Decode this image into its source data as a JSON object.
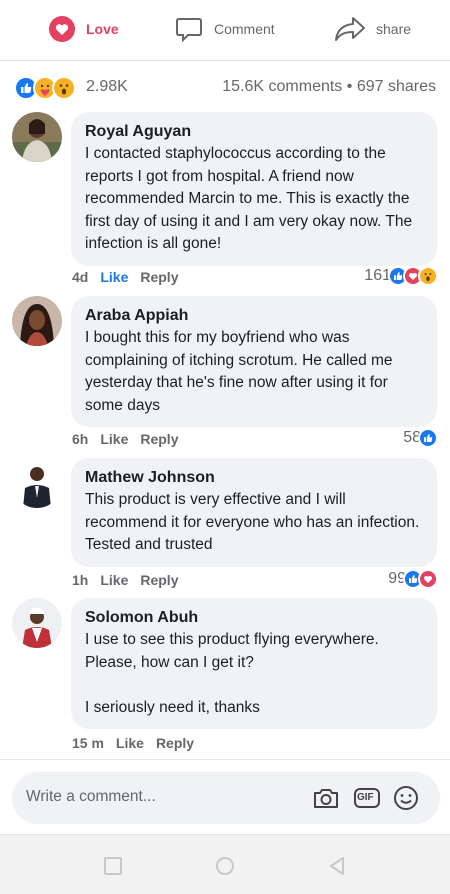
{
  "actions": {
    "love_label": "Love",
    "comment_label": "Comment",
    "share_label": "share"
  },
  "summary": {
    "reactions": [
      "like-reaction-icon",
      "love-reaction-icon",
      "wow-reaction-icon"
    ],
    "reaction_count": "2.98K",
    "comments_count": "15.6K comments",
    "separator": "•",
    "shares_count": "697 shares"
  },
  "comments": [
    {
      "author": "Royal Aguyan",
      "text": "I contacted staphylococcus according to the reports I got from hospital. A friend now recommended Marcin to me. This is exactly the first day of using it and I am very okay now. The infection is all gone!",
      "time": "4d",
      "like_label": "Like",
      "reply_label": "Reply",
      "reaction_count": "161",
      "reactions": [
        "like-reaction-icon",
        "love-reaction-icon",
        "wow-reaction-icon"
      ]
    },
    {
      "author": "Araba Appiah",
      "text": "I bought this for my boyfriend who was complaining of itching scrotum. He called me yesterday that he's fine now after using it for some days",
      "time": "6h",
      "like_label": "Like",
      "reply_label": "Reply",
      "reaction_count": "58",
      "reactions": [
        "like-reaction-icon"
      ]
    },
    {
      "author": "Mathew Johnson",
      "text": "This product is very effective and I will recommend it for everyone who has an infection. Tested and trusted",
      "time": "1h",
      "like_label": "Like",
      "reply_label": "Reply",
      "reaction_count": "99",
      "reactions": [
        "like-reaction-icon",
        "love-reaction-icon"
      ]
    },
    {
      "author": "Solomon Abuh",
      "text": "I use to see this product flying everywhere. Please, how can I get it?\n\nI seriously need it, thanks",
      "time": "15 m",
      "like_label": "Like",
      "reply_label": "Reply",
      "reaction_count": "",
      "reactions": []
    }
  ],
  "composer": {
    "placeholder": "Write a comment...",
    "gif_label": "GIF"
  },
  "colors": {
    "love_red": "#e4405f",
    "like_blue": "#1877f2",
    "bubble_bg": "#f0f2f5",
    "muted_text": "#65676b"
  }
}
